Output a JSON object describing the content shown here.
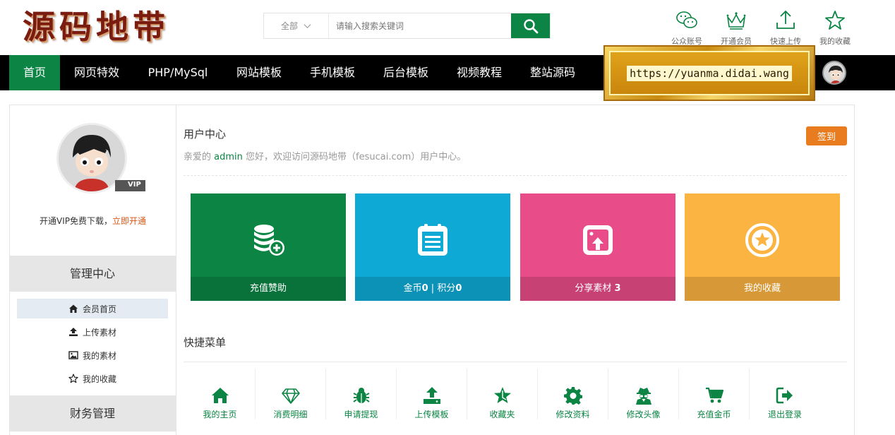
{
  "header": {
    "logo_text": "源码地带",
    "search": {
      "category": "全部",
      "placeholder": "请输入搜索关键词"
    },
    "quick_links": [
      {
        "label": "公众账号",
        "icon": "wechat-icon"
      },
      {
        "label": "开通会员",
        "icon": "crown-icon"
      },
      {
        "label": "快速上传",
        "icon": "upload-icon"
      },
      {
        "label": "我的收藏",
        "icon": "star-icon"
      }
    ]
  },
  "nav": {
    "items": [
      "首页",
      "网页特效",
      "PHP/MySql",
      "网站模板",
      "手机模板",
      "后台模板",
      "视频教程",
      "整站源码"
    ],
    "active_index": 0,
    "promo_url": "https://yuanma.didai.wang"
  },
  "sidebar": {
    "vip_badge": "VIP",
    "vip_note": "开通VIP免费下载，",
    "vip_link": "立即开通",
    "section_manage": "管理中心",
    "menu": [
      {
        "label": "会员首页",
        "icon": "home-icon"
      },
      {
        "label": "上传素材",
        "icon": "upload-icon"
      },
      {
        "label": "我的素材",
        "icon": "image-icon"
      },
      {
        "label": "我的收藏",
        "icon": "star-icon"
      }
    ],
    "section_finance": "财务管理"
  },
  "main": {
    "title": "用户中心",
    "welcome_prefix": "亲爱的",
    "username": "admin",
    "welcome_suffix": "您好，欢迎访问源码地带（fesucai.com）用户中心。",
    "checkin_label": "签到",
    "cards": [
      {
        "label": "充值赞助",
        "color": "#0b8444",
        "icon": "coins-add-icon"
      },
      {
        "label_a": "金币",
        "value_a": "0",
        "sep": " | ",
        "label_b": "积分",
        "value_b": "0",
        "color": "#0fa9d6",
        "icon": "notepad-icon"
      },
      {
        "label": "分享素材 ",
        "value": "3",
        "color": "#e84c89",
        "icon": "share-upload-icon"
      },
      {
        "label": "我的收藏",
        "color": "#fbb342",
        "icon": "star-circle-icon"
      }
    ],
    "quick_menu_title": "快捷菜单",
    "quick_menu": [
      {
        "label": "我的主页",
        "icon": "home-icon"
      },
      {
        "label": "消费明细",
        "icon": "diamond-icon"
      },
      {
        "label": "申请提现",
        "icon": "bug-icon"
      },
      {
        "label": "上传模板",
        "icon": "upload-icon"
      },
      {
        "label": "收藏夹",
        "icon": "star-icon"
      },
      {
        "label": "修改资料",
        "icon": "gear-icon"
      },
      {
        "label": "修改头像",
        "icon": "user-secret-icon"
      },
      {
        "label": "充值金币",
        "icon": "cart-icon"
      },
      {
        "label": "退出登录",
        "icon": "logout-icon"
      }
    ]
  },
  "colors": {
    "brand_green": "#0b8444",
    "nav_bg": "#000000",
    "accent_orange": "#e87c1e"
  }
}
